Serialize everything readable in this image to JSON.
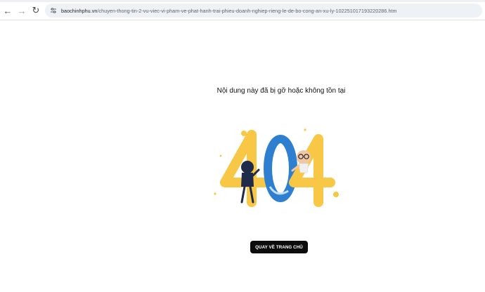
{
  "browser": {
    "url_domain": "baochinhphu.vn",
    "url_path": "/chuyen-thong-tin-2-vu-viec-vi-pham-ve-phat-hanh-trai-phieu-doanh-nghiep-rieng-le-de-bo-cong-an-xu-ly-102251017193220286.htm",
    "back_icon": "arrow-left",
    "forward_icon": "arrow-right",
    "reload_icon": "reload",
    "site_info_icon": "tune"
  },
  "page": {
    "message": "Nội dung này đã bị gỡ hoặc không tồn tại",
    "illustration_text": "404",
    "home_button_label": "QUAY VỀ TRANG CHỦ"
  },
  "colors": {
    "accent_yellow": "#f7c745",
    "accent_blue": "#2f7fd0",
    "button_bg": "#0c0c0c"
  }
}
